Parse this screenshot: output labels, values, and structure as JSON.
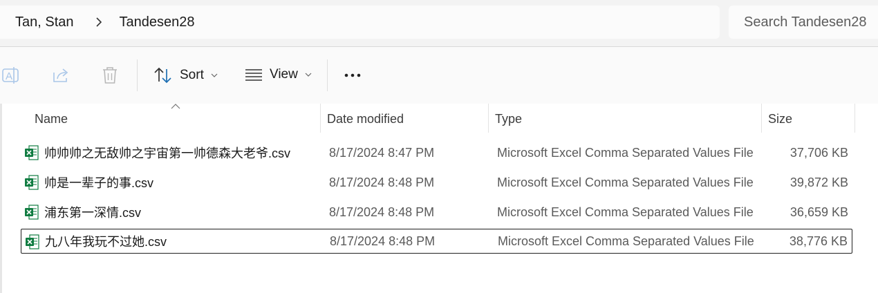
{
  "breadcrumb": {
    "items": [
      "Tan, Stan",
      "Tandesen28"
    ]
  },
  "search": {
    "placeholder": "Search Tandesen28"
  },
  "toolbar": {
    "sort_label": "Sort",
    "view_label": "View"
  },
  "columns": {
    "name": "Name",
    "date": "Date modified",
    "type": "Type",
    "size": "Size"
  },
  "files": [
    {
      "name": "帅帅帅之无敌帅之宇宙第一帅德森大老爷.csv",
      "date": "8/17/2024 8:47 PM",
      "type": "Microsoft Excel Comma Separated Values File",
      "size": "37,706 KB"
    },
    {
      "name": "帅是一辈子的事.csv",
      "date": "8/17/2024 8:48 PM",
      "type": "Microsoft Excel Comma Separated Values File",
      "size": "39,872 KB"
    },
    {
      "name": "浦东第一深情.csv",
      "date": "8/17/2024 8:48 PM",
      "type": "Microsoft Excel Comma Separated Values File",
      "size": "36,659 KB"
    },
    {
      "name": "九八年我玩不过她.csv",
      "date": "8/17/2024 8:48 PM",
      "type": "Microsoft Excel Comma Separated Values File",
      "size": "38,776 KB"
    }
  ],
  "colors": {
    "excel_green": "#107c41",
    "accent_blue": "#1f6fb3"
  }
}
